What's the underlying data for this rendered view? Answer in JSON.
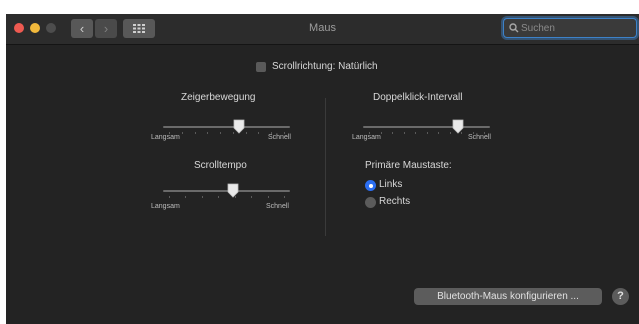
{
  "window": {
    "title": "Maus",
    "search": {
      "placeholder": "Suchen",
      "value": ""
    },
    "nav": {
      "back_glyph": "‹",
      "forward_glyph": "›"
    }
  },
  "scroll_direction": {
    "label": "Scrollrichtung: Natürlich",
    "checked": false
  },
  "tracking_speed": {
    "title": "Zeigerbewegung",
    "min_label": "Langsam",
    "max_label": "Schnell",
    "value_fraction": 0.6,
    "ticks": 10
  },
  "scroll_speed": {
    "title": "Scrolltempo",
    "min_label": "Langsam",
    "max_label": "Schnell",
    "value_fraction": 0.55,
    "ticks": 8
  },
  "double_click": {
    "title": "Doppelklick-Intervall",
    "min_label": "Langsam",
    "max_label": "Schnell",
    "value_fraction": 0.75,
    "ticks": 11
  },
  "primary_button": {
    "title": "Primäre Maustaste:",
    "options": [
      {
        "label": "Links",
        "selected": true
      },
      {
        "label": "Rechts",
        "selected": false
      }
    ]
  },
  "bluetooth_button": {
    "label": "Bluetooth-Maus konfigurieren ..."
  },
  "help_button": {
    "label": "?"
  },
  "colors": {
    "accent": "#2b6ef2",
    "window_bg": "#232323"
  }
}
